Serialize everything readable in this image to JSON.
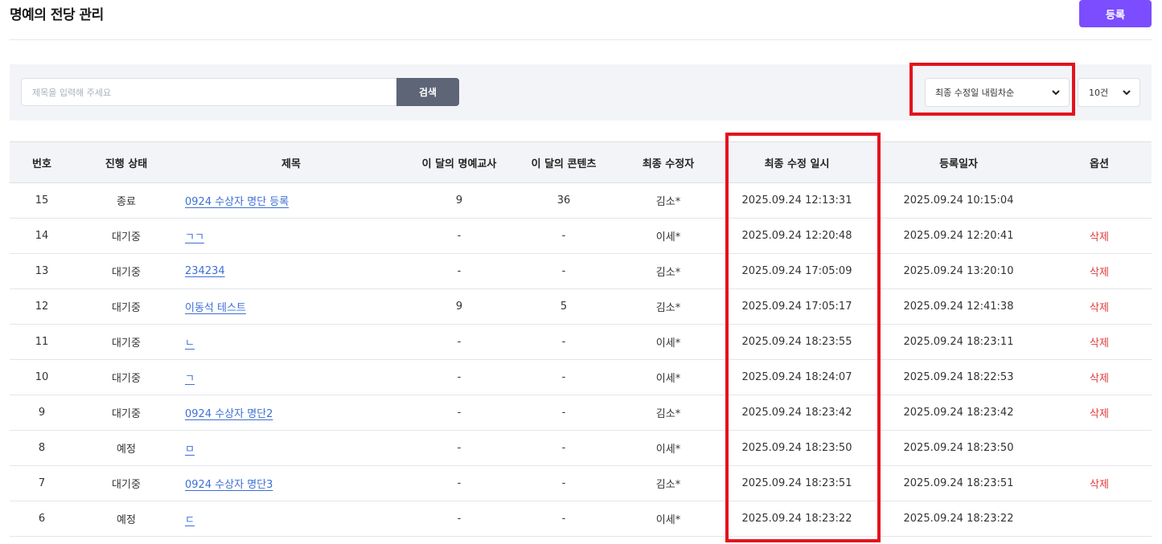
{
  "page": {
    "title": "명예의 전당 관리",
    "register_label": "등록"
  },
  "search": {
    "placeholder": "제목을 입력해 주세요",
    "button_label": "검색"
  },
  "sort": {
    "selected": "최종 수정일 내림차순"
  },
  "page_size": {
    "selected": "10건"
  },
  "colors": {
    "accent": "#7b4dff",
    "highlight": "#e3131d",
    "link": "#3d6fd6",
    "danger": "#e03a3a"
  },
  "table": {
    "headers": [
      "번호",
      "진행 상태",
      "제목",
      "이 달의 명예교사",
      "이 달의 콘텐츠",
      "최종 수정자",
      "최종 수정 일시",
      "등록일자",
      "옵션"
    ],
    "rows": [
      {
        "no": "15",
        "status": "종료",
        "title": "0924 수상자 명단 등록",
        "teachers": "9",
        "contents": "36",
        "editor": "김소*",
        "modified": "2025.09.24 12:13:31",
        "registered": "2025.09.24 10:15:04",
        "option": ""
      },
      {
        "no": "14",
        "status": "대기중",
        "title": "ㄱㄱ",
        "teachers": "-",
        "contents": "-",
        "editor": "이세*",
        "modified": "2025.09.24 12:20:48",
        "registered": "2025.09.24 12:20:41",
        "option": "삭제"
      },
      {
        "no": "13",
        "status": "대기중",
        "title": "234234",
        "teachers": "-",
        "contents": "-",
        "editor": "김소*",
        "modified": "2025.09.24 17:05:09",
        "registered": "2025.09.24 13:20:10",
        "option": "삭제"
      },
      {
        "no": "12",
        "status": "대기중",
        "title": "이동석 테스트",
        "teachers": "9",
        "contents": "5",
        "editor": "김소*",
        "modified": "2025.09.24 17:05:17",
        "registered": "2025.09.24 12:41:38",
        "option": "삭제"
      },
      {
        "no": "11",
        "status": "대기중",
        "title": "ㄴ",
        "teachers": "-",
        "contents": "-",
        "editor": "이세*",
        "modified": "2025.09.24 18:23:55",
        "registered": "2025.09.24 18:23:11",
        "option": "삭제"
      },
      {
        "no": "10",
        "status": "대기중",
        "title": "ㄱ",
        "teachers": "-",
        "contents": "-",
        "editor": "이세*",
        "modified": "2025.09.24 18:24:07",
        "registered": "2025.09.24 18:22:53",
        "option": "삭제"
      },
      {
        "no": "9",
        "status": "대기중",
        "title": "0924 수상자 명단2",
        "teachers": "-",
        "contents": "-",
        "editor": "김소*",
        "modified": "2025.09.24 18:23:42",
        "registered": "2025.09.24 18:23:42",
        "option": "삭제"
      },
      {
        "no": "8",
        "status": "예정",
        "title": "ㅁ",
        "teachers": "-",
        "contents": "-",
        "editor": "이세*",
        "modified": "2025.09.24 18:23:50",
        "registered": "2025.09.24 18:23:50",
        "option": ""
      },
      {
        "no": "7",
        "status": "대기중",
        "title": "0924 수상자 명단3",
        "teachers": "-",
        "contents": "-",
        "editor": "김소*",
        "modified": "2025.09.24 18:23:51",
        "registered": "2025.09.24 18:23:51",
        "option": "삭제"
      },
      {
        "no": "6",
        "status": "예정",
        "title": "ㄷ",
        "teachers": "-",
        "contents": "-",
        "editor": "이세*",
        "modified": "2025.09.24 18:23:22",
        "registered": "2025.09.24 18:23:22",
        "option": ""
      }
    ]
  }
}
